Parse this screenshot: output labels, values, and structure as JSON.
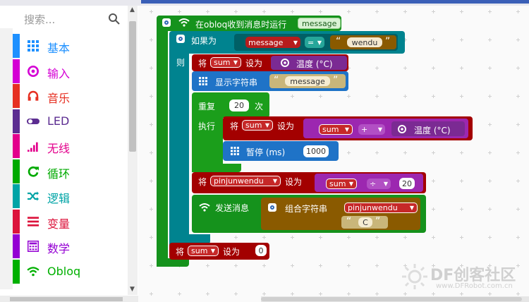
{
  "toolbox": {
    "search_placeholder": "搜索...",
    "categories": [
      {
        "label": "基本",
        "color": "#1e90ff",
        "icon": "grid-icon"
      },
      {
        "label": "输入",
        "color": "#d400d4",
        "icon": "target-icon"
      },
      {
        "label": "音乐",
        "color": "#e63022",
        "icon": "headphones-icon"
      },
      {
        "label": "LED",
        "color": "#5c2d91",
        "icon": "toggle-icon"
      },
      {
        "label": "无线",
        "color": "#e3008c",
        "icon": "signal-bars-icon"
      },
      {
        "label": "循环",
        "color": "#00aa00",
        "icon": "refresh-icon"
      },
      {
        "label": "逻辑",
        "color": "#00a4a6",
        "icon": "shuffle-icon"
      },
      {
        "label": "变量",
        "color": "#dc143c",
        "icon": "list-icon"
      },
      {
        "label": "数学",
        "color": "#9400d3",
        "icon": "calculator-icon"
      },
      {
        "label": "Obloq",
        "color": "#00b000",
        "icon": "wifi-icon"
      }
    ]
  },
  "blocks": {
    "event_label": "在obloq收到消息时运行",
    "event_param": "message",
    "if_label": "如果为",
    "if_var": "message",
    "if_op": "=",
    "if_str": "wendu",
    "then_label": "则",
    "set1_label": "将",
    "set1_var": "sum",
    "set1_to": "设为",
    "temp_label": "温度 (°C)",
    "show_label": "显示字符串",
    "show_str": "message",
    "repeat_label": "重复",
    "repeat_num": "20",
    "repeat_times": "次",
    "do_label": "执行",
    "set2_label": "将",
    "set2_var": "sum",
    "set2_to": "设为",
    "add_var": "sum",
    "add_op": "+",
    "add_temp": "温度 (°C)",
    "pause_label": "暂停 (ms)",
    "pause_num": "1000",
    "set3_label": "将",
    "set3_var": "pinjunwendu",
    "set3_to": "设为",
    "div_var": "sum",
    "div_op": "÷",
    "div_num": "20",
    "send_label": "发送消息",
    "join_label": "组合字符串",
    "join_var": "pinjunwendu",
    "join_str": "C",
    "set4_label": "将",
    "set4_var": "sum",
    "set4_to": "设为",
    "set4_num": "0"
  },
  "watermark": {
    "brand": "DF创客社区",
    "url": "www.DFRobot.com.cn"
  }
}
